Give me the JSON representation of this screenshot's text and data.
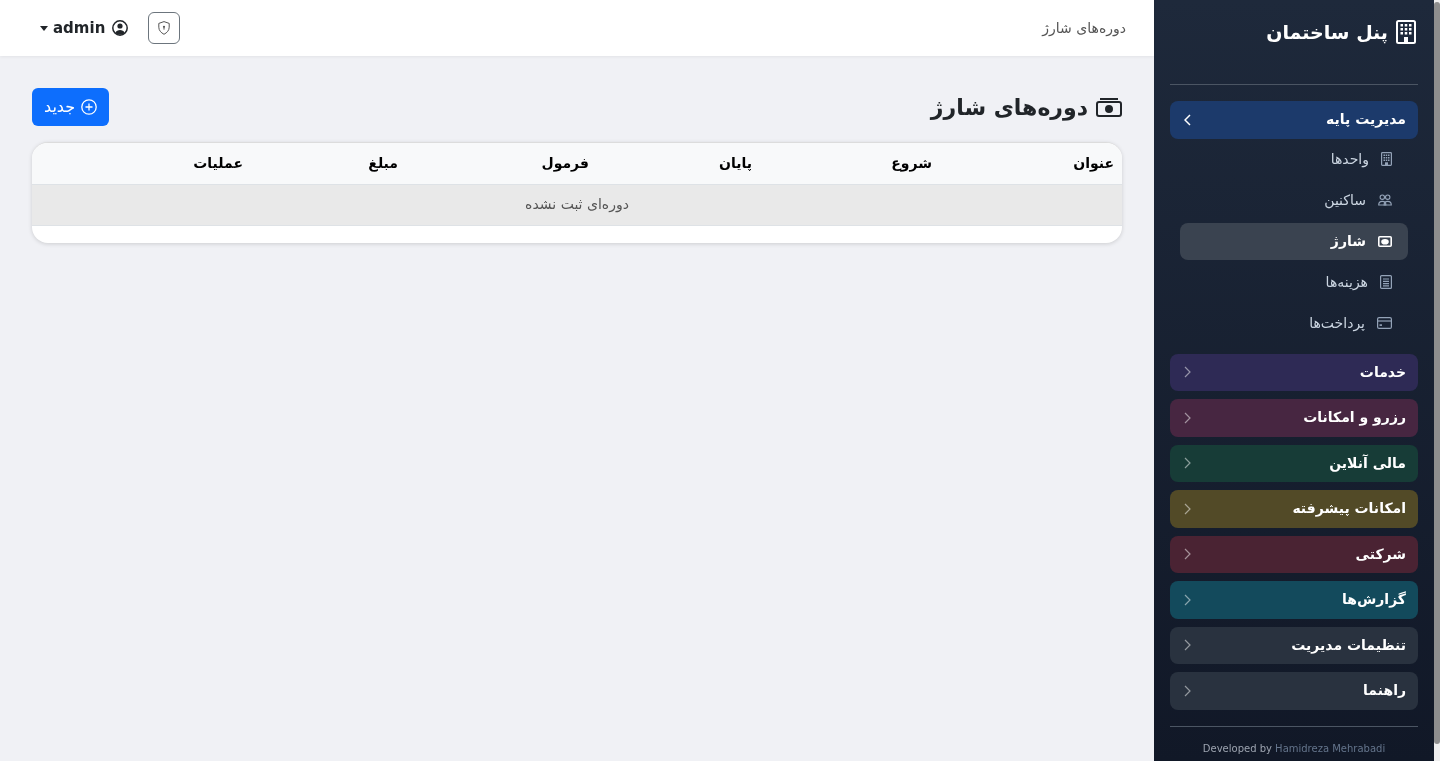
{
  "header": {
    "title": "دوره‌های شارژ",
    "user": "admin"
  },
  "sidebar": {
    "brand": "پنل ساختمان",
    "groups": [
      {
        "label": "مدیریت پایه",
        "color": "#1c3a6b",
        "expanded": true,
        "children": [
          {
            "label": "واحدها",
            "selected": false
          },
          {
            "label": "ساکنین",
            "selected": false
          },
          {
            "label": "شارژ",
            "selected": true
          },
          {
            "label": "هزینه‌ها",
            "selected": false
          },
          {
            "label": "پرداخت‌ها",
            "selected": false
          }
        ]
      },
      {
        "label": "خدمات",
        "color": "#2e2a55",
        "expanded": false
      },
      {
        "label": "رزرو و امکانات",
        "color": "#472641",
        "expanded": false
      },
      {
        "label": "مالی آنلاین",
        "color": "#173c37",
        "expanded": false
      },
      {
        "label": "امکانات پیشرفته",
        "color": "#524a27",
        "expanded": false
      },
      {
        "label": "شرکتی",
        "color": "#4a2333",
        "expanded": false
      },
      {
        "label": "گزارش‌ها",
        "color": "#134a5c",
        "expanded": false
      },
      {
        "label": "تنظیمات مدیریت",
        "color": "#29323f",
        "expanded": false
      },
      {
        "label": "راهنما",
        "color": "#29323f",
        "expanded": false
      }
    ],
    "footer": {
      "text": "Developed by",
      "link": "Hamidreza Mehrabadi"
    }
  },
  "page": {
    "title": "دوره‌های شارژ",
    "new_button": "جدید"
  },
  "table": {
    "columns": [
      "عنوان",
      "شروع",
      "پایان",
      "فرمول",
      "مبلغ",
      "عملیات"
    ],
    "empty_message": "دوره‌ای ثبت نشده"
  }
}
